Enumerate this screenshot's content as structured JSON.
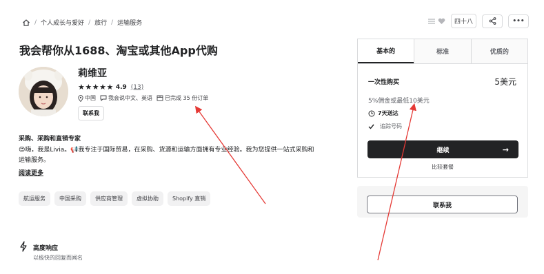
{
  "breadcrumb": {
    "items": [
      "个人成长与爱好",
      "旅行",
      "运输服务"
    ],
    "separator": "/"
  },
  "top_actions": {
    "save_count": "四十八",
    "list_icon": "list-icon",
    "heart_icon": "heart-icon",
    "share_icon": "share-icon",
    "more_label": "•••"
  },
  "gig": {
    "title": "我会帮你从1688、淘宝或其他App代购"
  },
  "seller": {
    "name": "莉维亚",
    "stars": "★★★★★",
    "score": "4.9",
    "reviews": "(13)",
    "country": "中国",
    "languages": "我会说中文、英语",
    "orders": "已完成 35 份订单",
    "contact_label": "联系我"
  },
  "about": {
    "title": "采购、采购和直销专家",
    "text": "😍嗨，我是Livia。📢我专注于国际贸易，在采购、货源和运输方面拥有专业经验。我为您提供一站式采购和运输服务。",
    "read_more": "阅读更多"
  },
  "tags": [
    "航运服务",
    "中国采购",
    "供应商管理",
    "虚拟协助",
    "Shopify 直销"
  ],
  "feature": {
    "title": "高度响应",
    "subtitle": "以极快的回复而闻名"
  },
  "package": {
    "tabs": [
      "基本的",
      "标准",
      "优质的"
    ],
    "active_tab": 0,
    "name": "一次性购买",
    "price": "5美元",
    "description": "5%佣金或最低10美元",
    "delivery": "7天送达",
    "tracking": "追踪号码",
    "continue_label": "继续",
    "continue_arrow": "→",
    "compare_label": "比较套餐"
  },
  "contact_box": {
    "label": "联系我"
  },
  "colors": {
    "primary_text": "#222325",
    "button_dark": "#222325",
    "annotation_arrow": "#e53935"
  }
}
